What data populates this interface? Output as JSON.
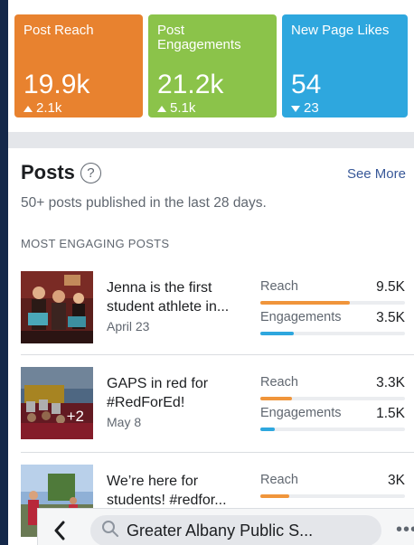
{
  "stats": [
    {
      "label": "Post Reach",
      "value": "19.9k",
      "delta": "2.1k",
      "direction": "up",
      "color": "#e8822f"
    },
    {
      "label": "Post Engagements",
      "value": "21.2k",
      "delta": "5.1k",
      "direction": "up",
      "color": "#8bc34a"
    },
    {
      "label": "New Page Likes",
      "value": "54",
      "delta": "23",
      "direction": "down",
      "color": "#2ea7de"
    }
  ],
  "posts": {
    "title": "Posts",
    "help_icon": "?",
    "see_more": "See More",
    "subtitle": "50+ posts published in the last 28 days.",
    "section_heading": "MOST ENGAGING POSTS",
    "reach_color": "#f0953b",
    "engagement_color": "#2ea7de",
    "items": [
      {
        "title": "Jenna is the first student athlete in...",
        "date": "April 23",
        "reach_label": "Reach",
        "reach_value": "9.5K",
        "reach_level": 0.62,
        "eng_label": "Engagements",
        "eng_value": "3.5K",
        "eng_level": 0.23
      },
      {
        "title": "GAPS in red for #RedForEd!",
        "date": "May 8",
        "photo_count": "+2",
        "reach_label": "Reach",
        "reach_value": "3.3K",
        "reach_level": 0.22,
        "eng_label": "Engagements",
        "eng_value": "1.5K",
        "eng_level": 0.1
      },
      {
        "title": "We’re here for students! #redfor...",
        "reach_label": "Reach",
        "reach_value": "3K",
        "reach_level": 0.2
      }
    ]
  },
  "bottom_bar": {
    "back_icon": "chevron-left-icon",
    "search_icon": "search-icon",
    "search_text": "Greater Albany Public S...",
    "more_icon": "•••"
  }
}
